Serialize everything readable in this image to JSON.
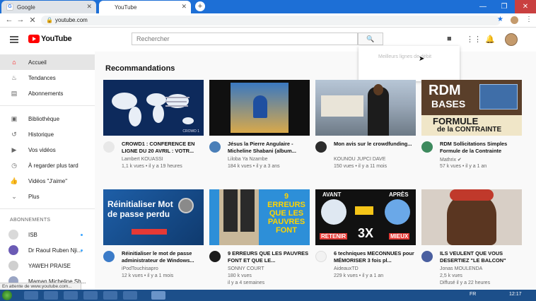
{
  "browser": {
    "tabs": [
      {
        "title": "Google",
        "active": false
      },
      {
        "title": "YouTube",
        "active": true
      }
    ],
    "url": "youtube.com",
    "new_tab": "+",
    "window_controls": [
      "—",
      "❐",
      "✕"
    ]
  },
  "header": {
    "logo": "YouTube",
    "search_placeholder": "Rechercher"
  },
  "sidebar": {
    "items": [
      {
        "label": "Accueil",
        "icon": "home-icon",
        "active": true
      },
      {
        "label": "Tendances",
        "icon": "fire-icon"
      },
      {
        "label": "Abonnements",
        "icon": "subscriptions-icon"
      },
      {
        "label": "Bibliothèque",
        "icon": "library-icon"
      },
      {
        "label": "Historique",
        "icon": "history-icon"
      },
      {
        "label": "Vos vidéos",
        "icon": "video-icon"
      },
      {
        "label": "À regarder plus tard",
        "icon": "clock-icon"
      },
      {
        "label": "Vidéos \"J'aime\"",
        "icon": "thumbs-up-icon"
      },
      {
        "label": "Plus",
        "icon": "chevron-down-icon"
      }
    ],
    "subscriptions_heading": "ABONNEMENTS",
    "subscriptions": [
      {
        "name": "ISB",
        "color": "#d9d9d9"
      },
      {
        "name": "Dr Raoul Ruben Nji...",
        "color": "#6b5bb5"
      },
      {
        "name": "YAWEH PRAISE",
        "color": "#cfcfcf"
      },
      {
        "name": "Maman Micheline Sh...",
        "color": "#9aa5c4"
      }
    ]
  },
  "main": {
    "section_title": "Recommandations",
    "dropdown_text": "Meilleurs lignes de débit",
    "videos": [
      {
        "title": "CROWD1 : CONFERENCE EN LIGNE DU 20 AVRIL : VOTR...",
        "channel": "Lambert KOUASSI",
        "meta": "1,1 k vues • il y a 19 heures",
        "avatar_color": "#e8e8e8"
      },
      {
        "title": "Jésus la Pierre Angulaire - Micheline Shabani (album...",
        "channel": "Liloba Ya Nzambe",
        "meta": "184 k vues • il y a 3 ans",
        "avatar_color": "#4a7fb8"
      },
      {
        "title": "Mon avis sur le crowdfunding...",
        "channel": "KOUNOU JUPCI DAVE",
        "meta": "150 vues • il y a 11 mois",
        "avatar_color": "#2c2c2c"
      },
      {
        "title": "RDM Sollicitations Simples Formule de la Contrainte",
        "channel": "Mathrix ✔",
        "meta": "57 k vues • il y a 1 an",
        "avatar_color": "#3e8a5e"
      },
      {
        "title": "Réinitialiser le mot de passe administrateur de Windows...",
        "channel": "iPodTouchisapro",
        "meta": "12 k vues • il y a 1 mois",
        "avatar_color": "#3b7bc8"
      },
      {
        "title": "9 ERREURS QUE LES PAUVRES FONT ET QUE LE...",
        "channel": "SONNY COURT",
        "meta": "180 k vues\nil y a 4 semaines",
        "meta1": "180 k vues",
        "meta2": "il y a 4 semaines",
        "avatar_color": "#1b1b1b"
      },
      {
        "title": "6 techniques MECONNUES pour MÉMORISER 3 fois pl...",
        "channel": "AideauxTD",
        "meta": "229 k vues • il y a 1 an",
        "avatar_color": "#f2f2f2"
      },
      {
        "title": "ILS VEULENT QUE VOUS DESERTIEZ \"LE BALCON\"",
        "channel": "Jonas MOULENDA",
        "meta": "2,5 k vues",
        "meta2": "Diffusé il y a 22 heures",
        "avatar_color": "#4a5fa0"
      }
    ],
    "thumb_texts": {
      "rdm_line1": "RDM",
      "rdm_line2": "BASES",
      "rdm_line3": "FORMULE",
      "rdm_line4": "de la CONTRAINTE",
      "reset_text": "Réinitialiser Mot de passe perdu",
      "errors_text": "9 ERREURS QUE LES PAUVRES FONT",
      "avant": "AVANT",
      "apres": "APRÈS",
      "retenir": "RETENIR",
      "mieux": "MIEUX",
      "three_x": "3X",
      "crowd_caption": "CROWD 1"
    }
  },
  "status_bar": "En attente de www.youtube.com...",
  "taskbar": {
    "lang": "FR",
    "clock": "12:17"
  }
}
